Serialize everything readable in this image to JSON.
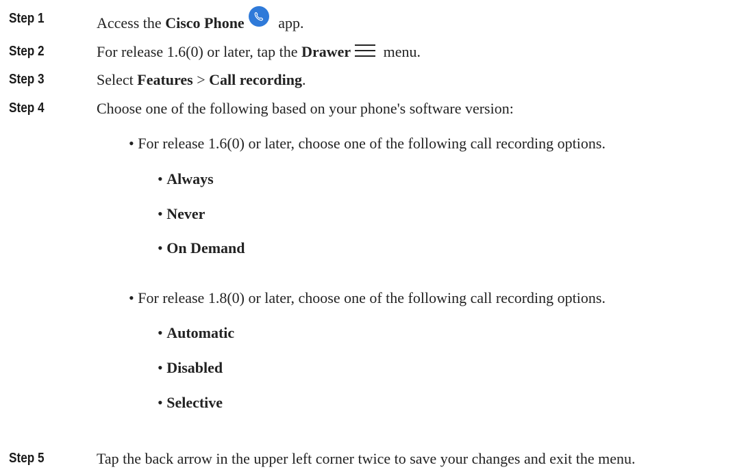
{
  "steps": [
    {
      "label": "Step 1",
      "prefix": "Access the ",
      "bold": "Cisco Phone",
      "suffix": " app.",
      "icon": "phone-app-icon"
    },
    {
      "label": "Step 2",
      "prefix": "For release 1.6(0) or later, tap the ",
      "bold": "Drawer",
      "suffix": " menu.",
      "icon": "hamburger-menu-icon"
    },
    {
      "label": "Step 3",
      "prefix": "Select ",
      "bold1": "Features",
      "sep": " > ",
      "bold2": "Call recording",
      "suffix": "."
    },
    {
      "label": "Step 4",
      "text": "Choose one of the following based on your phone's software version:"
    },
    {
      "label": "Step 5",
      "text": "Tap the back arrow in the upper left corner twice to save your changes and exit the menu."
    }
  ],
  "options": [
    {
      "text": "For release 1.6(0) or later, choose one of the following call recording options.",
      "items": [
        "Always",
        "Never",
        "On Demand"
      ]
    },
    {
      "text": "For release 1.8(0) or later, choose one of the following call recording options.",
      "items": [
        "Automatic",
        "Disabled",
        "Selective"
      ]
    }
  ],
  "bullet_char": "•",
  "colors": {
    "phone_icon": "#2f7ad9",
    "text": "#222222"
  }
}
